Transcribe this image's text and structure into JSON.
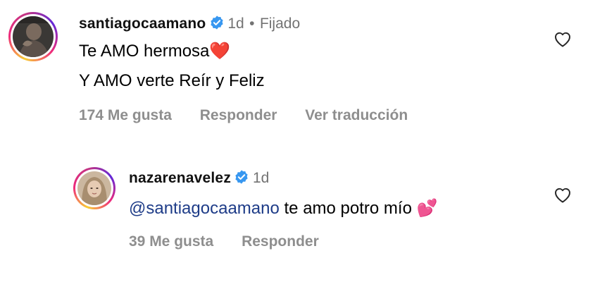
{
  "comments": [
    {
      "username": "santiagocaamano",
      "age": "1d",
      "separator": "•",
      "pinned_label": "Fijado",
      "lines": [
        "Te AMO hermosa",
        "Y AMO verte Reír y Feliz"
      ],
      "line1_emoji": "❤️",
      "likes_label": "174 Me gusta",
      "reply_label": "Responder",
      "translate_label": "Ver traducción"
    },
    {
      "username": "nazarenavelez",
      "age": "1d",
      "mention": "@santiagocaamano",
      "text": "te amo potro mío",
      "emoji": "💕",
      "likes_label": "39 Me gusta",
      "reply_label": "Responder"
    }
  ],
  "colors": {
    "verified": "#3797f0",
    "mention": "#1e3c88",
    "muted": "#737373"
  }
}
